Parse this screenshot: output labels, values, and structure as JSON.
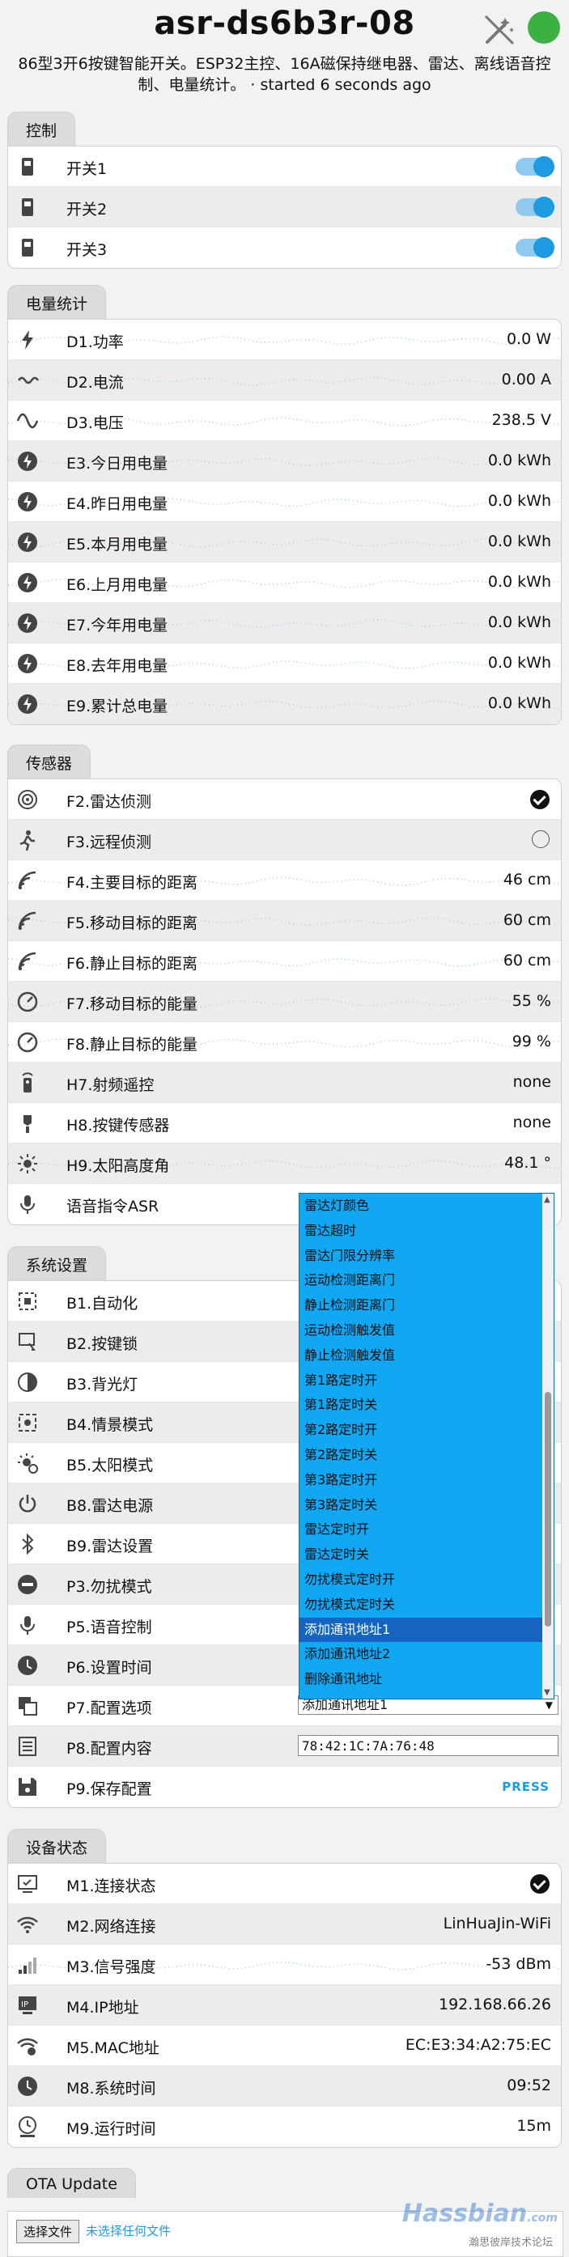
{
  "header": {
    "title": "asr-ds6b3r-08",
    "subtitle": "86型3开6按键智能开关。ESP32主控、16A磁保持继电器、雷达、离线语音控制、电量统计。 · started 6 seconds ago"
  },
  "controls": {
    "tab": "控制",
    "rows": [
      {
        "label": "开关1",
        "on": true
      },
      {
        "label": "开关2",
        "on": true
      },
      {
        "label": "开关3",
        "on": true
      }
    ]
  },
  "power": {
    "tab": "电量统计",
    "rows": [
      {
        "label": "D1.功率",
        "value": "0.0 W",
        "icon": "bolt-icon"
      },
      {
        "label": "D2.电流",
        "value": "0.00 A",
        "icon": "current-wave-icon"
      },
      {
        "label": "D3.电压",
        "value": "238.5 V",
        "icon": "sine-wave-icon"
      },
      {
        "label": "E3.今日用电量",
        "value": "0.0 kWh",
        "icon": "energy-icon"
      },
      {
        "label": "E4.昨日用电量",
        "value": "0.0 kWh",
        "icon": "energy-icon"
      },
      {
        "label": "E5.本月用电量",
        "value": "0.0 kWh",
        "icon": "energy-icon"
      },
      {
        "label": "E6.上月用电量",
        "value": "0.0 kWh",
        "icon": "energy-icon"
      },
      {
        "label": "E7.今年用电量",
        "value": "0.0 kWh",
        "icon": "energy-icon"
      },
      {
        "label": "E8.去年用电量",
        "value": "0.0 kWh",
        "icon": "energy-icon"
      },
      {
        "label": "E9.累计总电量",
        "value": "0.0 kWh",
        "icon": "energy-icon"
      }
    ]
  },
  "sensors": {
    "tab": "传感器",
    "rows": [
      {
        "label": "F2.雷达侦测",
        "value": "",
        "icon": "radar-icon"
      },
      {
        "label": "F3.远程侦测",
        "value": "",
        "icon": "motion-icon"
      },
      {
        "label": "F4.主要目标的距离",
        "value": "46 cm",
        "icon": "signal-distance-icon"
      },
      {
        "label": "F5.移动目标的距离",
        "value": "60 cm",
        "icon": "signal-distance-icon"
      },
      {
        "label": "F6.静止目标的距离",
        "value": "60 cm",
        "icon": "signal-distance-icon"
      },
      {
        "label": "F7.移动目标的能量",
        "value": "55 %",
        "icon": "gauge-icon"
      },
      {
        "label": "F8.静止目标的能量",
        "value": "99 %",
        "icon": "gauge-icon"
      },
      {
        "label": "H7.射频遥控",
        "value": "none",
        "icon": "remote-icon"
      },
      {
        "label": "H8.按键传感器",
        "value": "none",
        "icon": "key-icon"
      },
      {
        "label": "H9.太阳高度角",
        "value": "48.1 °",
        "icon": "sun-icon"
      },
      {
        "label": "语音指令ASR",
        "value": "",
        "icon": "microphone-icon"
      }
    ]
  },
  "system": {
    "tab": "系统设置",
    "rows": [
      {
        "label": "B1.自动化",
        "icon": "automation-icon"
      },
      {
        "label": "B2.按键锁",
        "icon": "key-lock-icon"
      },
      {
        "label": "B3.背光灯",
        "icon": "backlight-icon"
      },
      {
        "label": "B4.情景模式",
        "icon": "scene-icon"
      },
      {
        "label": "B5.太阳模式",
        "icon": "sun-mode-icon"
      },
      {
        "label": "B8.雷达电源",
        "icon": "power-icon"
      },
      {
        "label": "B9.雷达设置",
        "icon": "bluetooth-icon"
      },
      {
        "label": "P3.勿扰模式",
        "icon": "minus-circle-icon"
      },
      {
        "label": "P5.语音控制",
        "icon": "microphone-icon"
      },
      {
        "label": "P6.设置时间",
        "icon": "clock-icon"
      },
      {
        "label": "P7.配置选项",
        "icon": "copy-icon"
      },
      {
        "label": "P8.配置内容",
        "icon": "list-icon"
      },
      {
        "label": "P9.保存配置",
        "icon": "save-icon"
      }
    ],
    "p7_selected": "添加通讯地址1",
    "p8_value": "78:42:1C:7A:76:48",
    "p9_button": "PRESS",
    "dropdown_options": [
      "雷达灯颜色",
      "雷达超时",
      "雷达门限分辨率",
      "运动检测距离门",
      "静止检测距离门",
      "运动检测触发值",
      "静止检测触发值",
      "第1路定时开",
      "第1路定时关",
      "第2路定时开",
      "第2路定时关",
      "第3路定时开",
      "第3路定时关",
      "雷达定时开",
      "雷达定时关",
      "勿扰模式定时开",
      "勿扰模式定时关",
      "添加通讯地址1",
      "添加通讯地址2",
      "删除通讯地址"
    ],
    "dropdown_highlight": "添加通讯地址1"
  },
  "status": {
    "tab": "设备状态",
    "rows": [
      {
        "label": "M1.连接状态",
        "value": "",
        "icon": "monitor-check-icon"
      },
      {
        "label": "M2.网络连接",
        "value": "LinHuaJin-WiFi",
        "icon": "wifi-icon"
      },
      {
        "label": "M3.信号强度",
        "value": "-53 dBm",
        "icon": "signal-bars-icon"
      },
      {
        "label": "M4.IP地址",
        "value": "192.168.66.26",
        "icon": "ip-icon"
      },
      {
        "label": "M5.MAC地址",
        "value": "EC:E3:34:A2:75:EC",
        "icon": "wifi-settings-icon"
      },
      {
        "label": "M8.系统时间",
        "value": "09:52",
        "icon": "clock-icon"
      },
      {
        "label": "M9.运行时间",
        "value": "15m",
        "icon": "uptime-icon"
      }
    ]
  },
  "ota": {
    "tab": "OTA Update",
    "file_button": "选择文件",
    "file_text": "未选择任何文件"
  },
  "watermark": {
    "text": "Hassbian",
    "sub": "瀚思彼岸技术论坛",
    "com": ".com"
  },
  "colors": {
    "accent": "#1e9be0",
    "status_green": "#3cb043",
    "dropdown_bg": "#12a7f2"
  }
}
